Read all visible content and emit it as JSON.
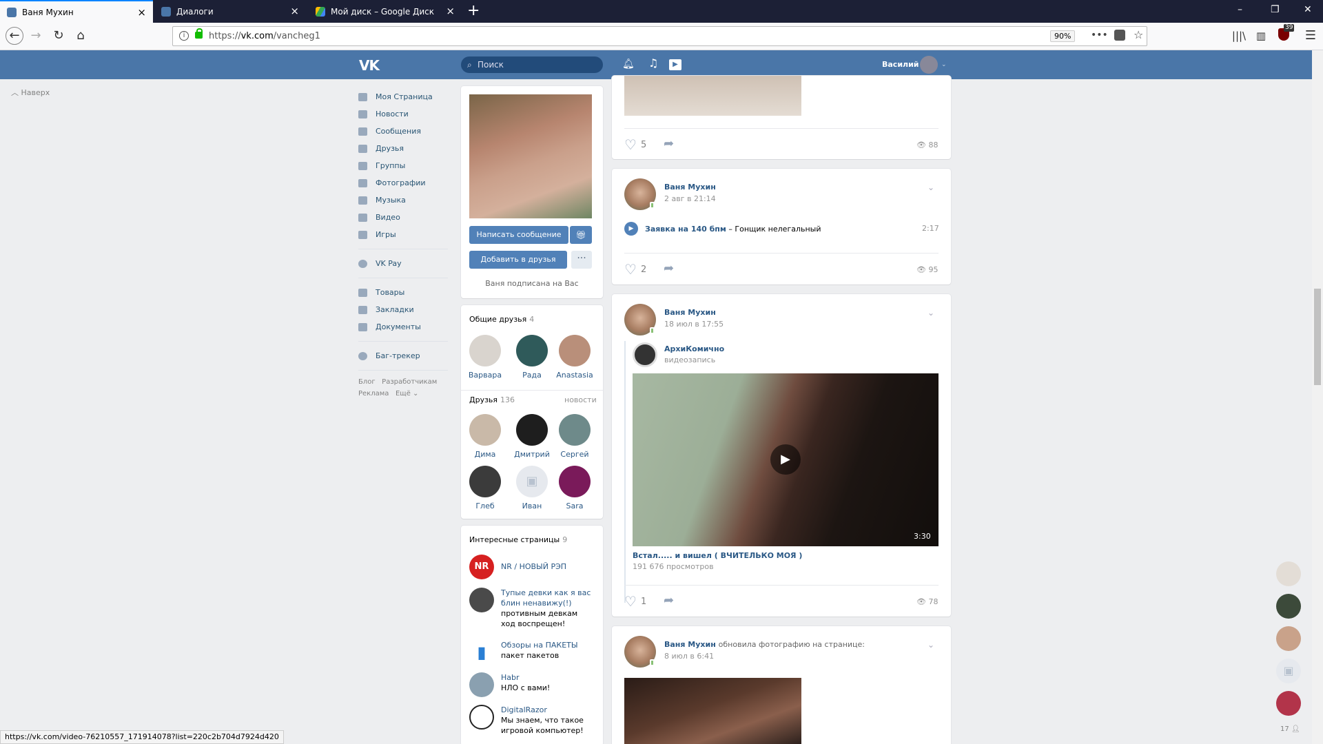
{
  "browser": {
    "tabs": [
      {
        "label": "Ваня Мухин",
        "active": true
      },
      {
        "label": "Диалоги",
        "active": false
      },
      {
        "label": "Мой диск – Google Диск",
        "active": false
      }
    ],
    "new_tab": "+",
    "url_prefix": "https://",
    "url_host": "vk.com",
    "url_path": "/vancheg1",
    "zoom": "90%",
    "status_url": "https://vk.com/video-76210557_171914078?list=220c2b704d7924d420",
    "ublock_count": "39"
  },
  "vk_header": {
    "logo": "VK",
    "search_placeholder": "Поиск",
    "user_name": "Василий"
  },
  "up_button": "Наверх",
  "left_menu": {
    "items": [
      "Моя Страница",
      "Новости",
      "Сообщения",
      "Друзья",
      "Группы",
      "Фотографии",
      "Музыка",
      "Видео",
      "Игры"
    ],
    "pay": "VK Pay",
    "extra": [
      "Товары",
      "Закладки",
      "Документы"
    ],
    "bug": "Баг-трекер",
    "footer": [
      "Блог",
      "Разработчикам",
      "Реклама",
      "Ещё"
    ]
  },
  "profile": {
    "write_btn": "Написать сообщение",
    "add_btn": "Добавить в друзья",
    "more_btn": "···",
    "subscribed_text": "Ваня подписана на Вас"
  },
  "common_friends": {
    "title": "Общие друзья",
    "count": "4",
    "items": [
      {
        "name": "Варвара",
        "color": "#d9d4ce"
      },
      {
        "name": "Рада",
        "color": "#2f5a5a"
      },
      {
        "name": "Anastasia",
        "color": "#b98f7a"
      }
    ]
  },
  "friends": {
    "title": "Друзья",
    "count": "136",
    "news_link": "новости",
    "items": [
      {
        "name": "Дима",
        "color": "#c9b9a8"
      },
      {
        "name": "Дмитрий",
        "color": "#1e1e1e"
      },
      {
        "name": "Сергей",
        "color": "#6e8a8a"
      },
      {
        "name": "Глеб",
        "color": "#3b3b3b"
      },
      {
        "name": "Иван",
        "color": "#e6e9ee"
      },
      {
        "name": "Sara",
        "color": "#7a1a5a"
      }
    ]
  },
  "interesting": {
    "title": "Интересные страницы",
    "count": "9",
    "items": [
      {
        "title": "NR / НОВЫЙ РЭП",
        "sub": "",
        "color": "#d62020"
      },
      {
        "title": "Тупые девки как я вас блин ненавижу(!)",
        "sub": "противным девкам ход воспрещен!",
        "color": "#4a4a4a"
      },
      {
        "title": "Обзоры на ПАКЕТЫ",
        "sub": "пакет пакетов",
        "color": "#2a7fd4"
      },
      {
        "title": "Habr",
        "sub": "НЛО с вами!",
        "color": "#8aa0b0"
      },
      {
        "title": "DigitalRazor",
        "sub": "Мы знаем, что такое игровой компьютер!",
        "color": "#222222"
      }
    ]
  },
  "posts": [
    {
      "likes": "5",
      "views": "88"
    },
    {
      "author": "Ваня Мухин",
      "date": "2 авг в 21:14",
      "track_artist": "Заявка на 140 бпм",
      "track_dash": "–",
      "track_title": "Гонщик нелегальный",
      "track_time": "2:17",
      "likes": "2",
      "views": "95"
    },
    {
      "author": "Ваня Мухин",
      "date": "18 июл в 17:55",
      "repost_author": "АрхиКомично",
      "repost_type": "видеозапись",
      "video_duration": "3:30",
      "video_title": "Встал..... и вишел ( ВЧИТЕЛЬКО МОЯ )",
      "video_views": "191 676 просмотров",
      "likes": "1",
      "views": "78"
    },
    {
      "author": "Ваня Мухин",
      "action": "обновила фотографию на странице:",
      "date": "8 июл в 6:41"
    }
  ],
  "side_chat_count": "17"
}
